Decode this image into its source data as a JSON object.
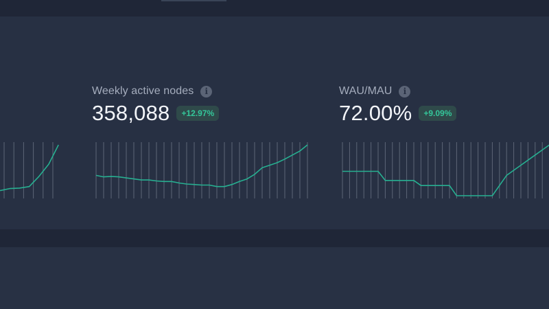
{
  "metrics": [
    {
      "label": "Weekly active nodes",
      "value": "358,088",
      "delta": "+12.97%",
      "info_icon": "info-icon"
    },
    {
      "label": "WAU/MAU",
      "value": "72.00%",
      "delta": "+9.09%",
      "info_icon": "info-icon"
    }
  ],
  "colors": {
    "background": "#283144",
    "accent_line": "#27b091",
    "positive_text": "#34c79a",
    "positive_bg": "#2f4a4a",
    "grid": "#8a93a3"
  },
  "chart_data": [
    {
      "type": "line",
      "series": [
        {
          "values": [
            10,
            14,
            15,
            18,
            38,
            62,
            100
          ]
        }
      ],
      "ylim": [
        0,
        100
      ],
      "grid": "vertical"
    },
    {
      "type": "line",
      "series": [
        {
          "values": [
            40,
            37,
            38,
            37,
            35,
            33,
            31,
            31,
            29,
            28,
            28,
            25,
            23,
            22,
            21,
            21,
            18,
            18,
            22,
            28,
            33,
            42,
            55,
            60,
            65,
            72,
            80,
            88,
            100
          ]
        }
      ],
      "ylim": [
        0,
        100
      ],
      "grid": "vertical"
    },
    {
      "type": "line",
      "series": [
        {
          "values": [
            48,
            48,
            48,
            48,
            48,
            48,
            30,
            30,
            30,
            30,
            30,
            20,
            20,
            20,
            20,
            20,
            0,
            0,
            0,
            0,
            0,
            0,
            20,
            40,
            50,
            60,
            70,
            80,
            90,
            100
          ]
        }
      ],
      "ylim": [
        0,
        100
      ],
      "grid": "vertical"
    }
  ]
}
